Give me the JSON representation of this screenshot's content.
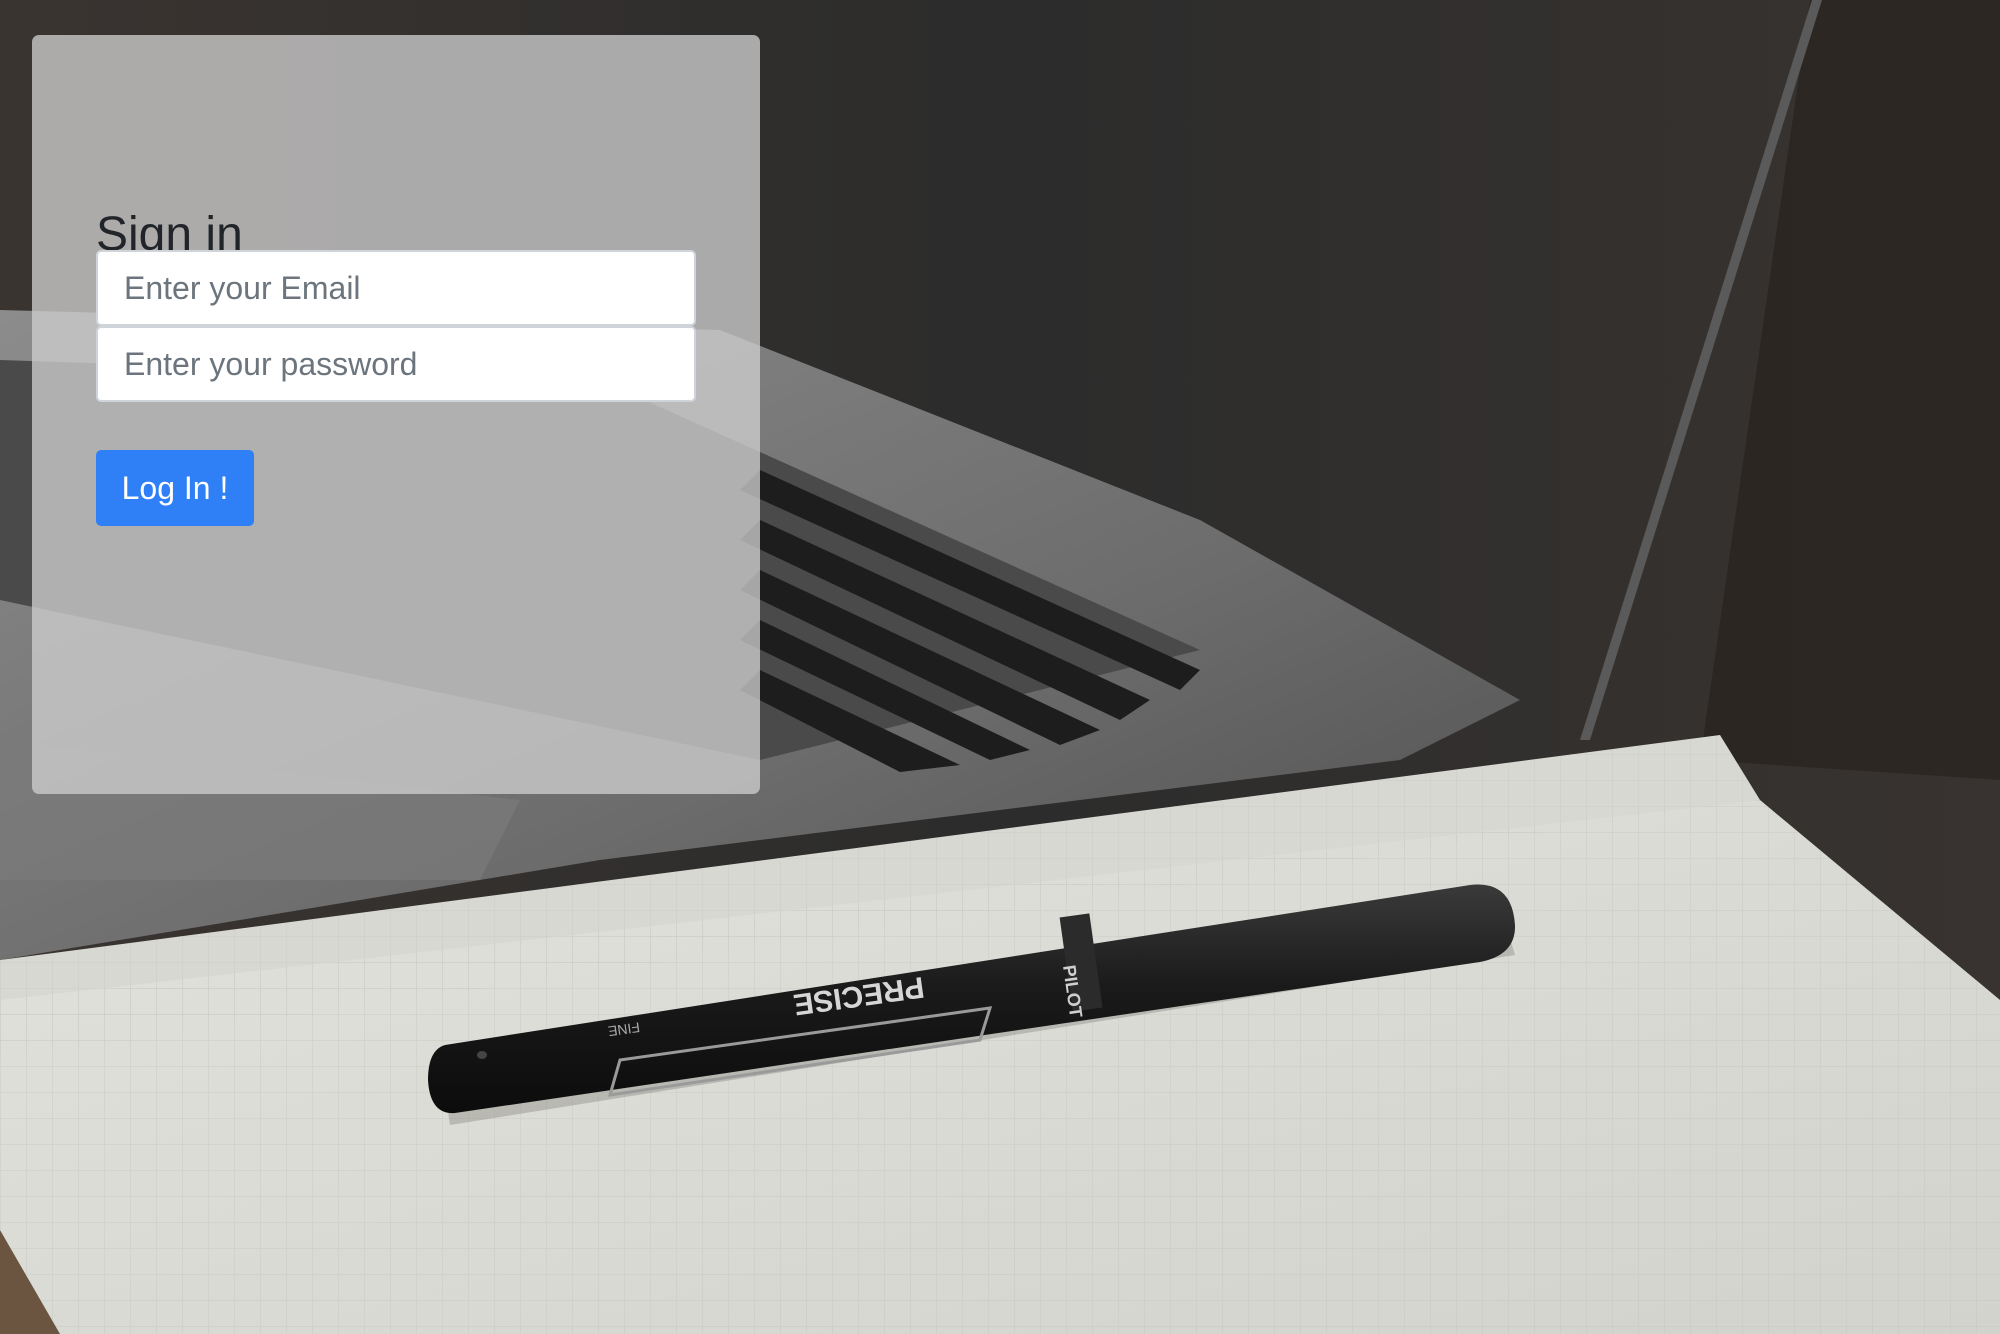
{
  "login": {
    "title": "Sign in",
    "email": {
      "placeholder": "Enter your Email",
      "value": ""
    },
    "password": {
      "placeholder": "Enter your password",
      "value": ""
    },
    "submit_label": "Log In !"
  },
  "background": {
    "pen_brand_text": "PRECISE",
    "pen_tip_text": "FINE",
    "pen_cap_text": "PILOT"
  },
  "colors": {
    "primary_button": "#2f80f6",
    "card_overlay": "#cdcdcd",
    "heading_text": "#212529"
  }
}
